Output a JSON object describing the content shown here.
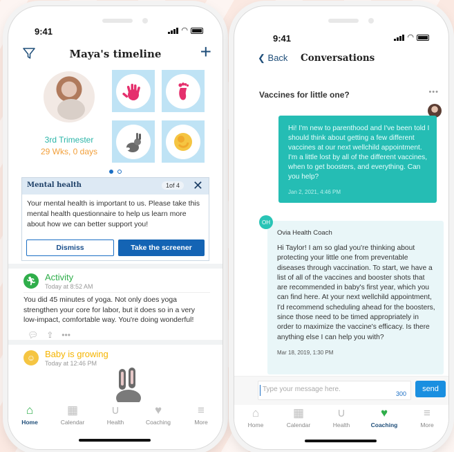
{
  "status_time": "9:41",
  "left": {
    "header_title": "Maya's timeline",
    "profile": {
      "trimester": "3rd Trimester",
      "weeks": "29 Wks, 0 days"
    },
    "mental_health": {
      "title": "Mental health",
      "page": "1of 4",
      "body": "Your mental health is important to us. Please take this mental health questionnaire to help us learn more about how we can better support you!",
      "dismiss_label": "Dismiss",
      "screener_label": "Take the screener"
    },
    "activity": {
      "title": "Activity",
      "time": "Today at 8:52 AM",
      "text": "You did 45 minutes of yoga. Not only does yoga strengthen your core for labor, but it does so in a very low-impact, comfortable way. You're doing wonderful!"
    },
    "growing": {
      "title": "Baby is growing",
      "time": "Today at 12:46 PM"
    }
  },
  "right": {
    "back_label": "Back",
    "header_title": "Conversations",
    "thread_title": "Vaccines for little one?",
    "more": "•••",
    "user_message": "Hi! I'm new to parenthood and I've been told I should think about getting a few different vaccines at our next wellchild appointment. I'm a little lost by all of the different vaccines, when to get boosters, and everything. Can you help?",
    "user_time": "Jan 2, 2021, 4:46 PM",
    "coach_avatar": "OH",
    "coach_name": "Ovia Health Coach",
    "coach_message": "Hi Taylor! I am so glad you're thinking about protecting your little one from preventable diseases through vaccination. To start, we have a list of all of the vaccines and booster shots that are recommended in baby's first year, which you can find here. At your next wellchild appointment, I'd recommend scheduling ahead for the boosters, since those need to be timed appropriately in order to maximize the vaccine's efficacy. Is there anything else I can help you with?",
    "coach_time": "Mar 18, 2019, 1:30 PM",
    "input_placeholder": "Type your message here.",
    "char_count": "300",
    "send_label": "send"
  },
  "tabs": [
    {
      "label": "Home",
      "icon": "home-icon"
    },
    {
      "label": "Calendar",
      "icon": "calendar-icon"
    },
    {
      "label": "Health",
      "icon": "stethoscope-icon"
    },
    {
      "label": "Coaching",
      "icon": "heart-pulse-icon"
    },
    {
      "label": "More",
      "icon": "menu-icon"
    }
  ],
  "colors": {
    "primary_blue": "#1464b4",
    "navy": "#1f4e79",
    "teal": "#25bdb4",
    "green": "#2fae4a",
    "orange": "#f29f3a",
    "yellow": "#f5c542"
  }
}
